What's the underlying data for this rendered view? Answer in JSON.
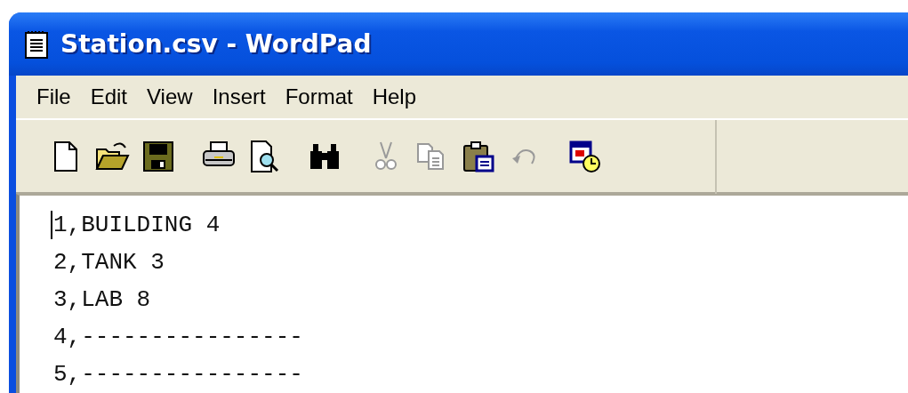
{
  "window": {
    "title": "Station.csv - WordPad"
  },
  "menu": [
    "File",
    "Edit",
    "View",
    "Insert",
    "Format",
    "Help"
  ],
  "toolbar": [
    [
      {
        "kind": "new",
        "disabled": false
      },
      {
        "kind": "open",
        "disabled": false
      },
      {
        "kind": "save",
        "disabled": false
      }
    ],
    [
      {
        "kind": "print",
        "disabled": false
      },
      {
        "kind": "preview",
        "disabled": false
      }
    ],
    [
      {
        "kind": "find",
        "disabled": false
      }
    ],
    [
      {
        "kind": "cut",
        "disabled": true
      },
      {
        "kind": "copy",
        "disabled": true
      },
      {
        "kind": "paste",
        "disabled": false
      },
      {
        "kind": "undo",
        "disabled": true
      }
    ],
    [
      {
        "kind": "datetime",
        "disabled": false
      }
    ]
  ],
  "document": {
    "lines": [
      "1,BUILDING 4",
      "2,TANK 3",
      "3,LAB 8",
      "4,----------------",
      "5,----------------"
    ]
  }
}
